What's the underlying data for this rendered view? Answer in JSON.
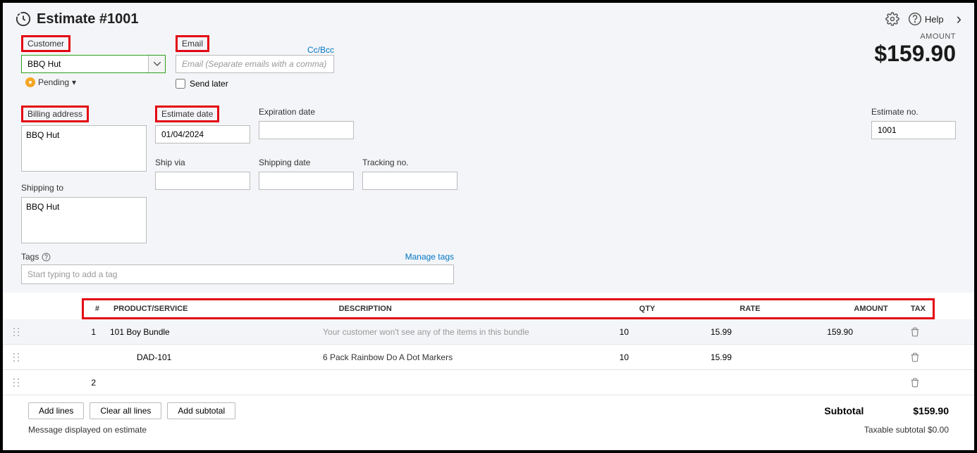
{
  "header": {
    "title": "Estimate #1001",
    "help_label": "Help"
  },
  "amount": {
    "label": "AMOUNT",
    "value": "$159.90"
  },
  "customer": {
    "label": "Customer",
    "value": "BBQ Hut"
  },
  "email": {
    "label": "Email",
    "ccbcc": "Cc/Bcc",
    "placeholder": "Email (Separate emails with a comma)",
    "send_later_label": "Send later"
  },
  "status": {
    "label": "Pending"
  },
  "billing": {
    "label": "Billing address",
    "value": "BBQ Hut"
  },
  "estimate_date": {
    "label": "Estimate date",
    "value": "01/04/2024"
  },
  "expiration": {
    "label": "Expiration date",
    "value": ""
  },
  "ship_via": {
    "label": "Ship via",
    "value": ""
  },
  "shipping_date": {
    "label": "Shipping date",
    "value": ""
  },
  "tracking_no": {
    "label": "Tracking no.",
    "value": ""
  },
  "shipping_to": {
    "label": "Shipping to",
    "value": "BBQ Hut"
  },
  "estimate_no": {
    "label": "Estimate no.",
    "value": "1001"
  },
  "tags": {
    "label": "Tags",
    "manage": "Manage tags",
    "placeholder": "Start typing to add a tag"
  },
  "table": {
    "headers": {
      "num": "#",
      "product": "PRODUCT/SERVICE",
      "description": "DESCRIPTION",
      "qty": "QTY",
      "rate": "RATE",
      "amount": "AMOUNT",
      "tax": "TAX"
    },
    "rows": [
      {
        "num": "1",
        "product": "101 Boy Bundle",
        "desc": "Your customer won't see any of the items in this bundle",
        "desc_muted": true,
        "qty": "10",
        "rate": "15.99",
        "amount": "159.90",
        "indent": false
      },
      {
        "num": "",
        "product": "DAD-101",
        "desc": "6 Pack Rainbow Do A Dot Markers",
        "desc_muted": false,
        "qty": "10",
        "rate": "15.99",
        "amount": "",
        "indent": true
      },
      {
        "num": "2",
        "product": "",
        "desc": "",
        "qty": "",
        "rate": "",
        "amount": "",
        "indent": false
      }
    ]
  },
  "buttons": {
    "add_lines": "Add lines",
    "clear_all": "Clear all lines",
    "add_subtotal": "Add subtotal"
  },
  "subtotal": {
    "label": "Subtotal",
    "value": "$159.90"
  },
  "message_label": "Message displayed on estimate",
  "taxable": {
    "label": "Taxable subtotal",
    "value": "$0.00"
  }
}
